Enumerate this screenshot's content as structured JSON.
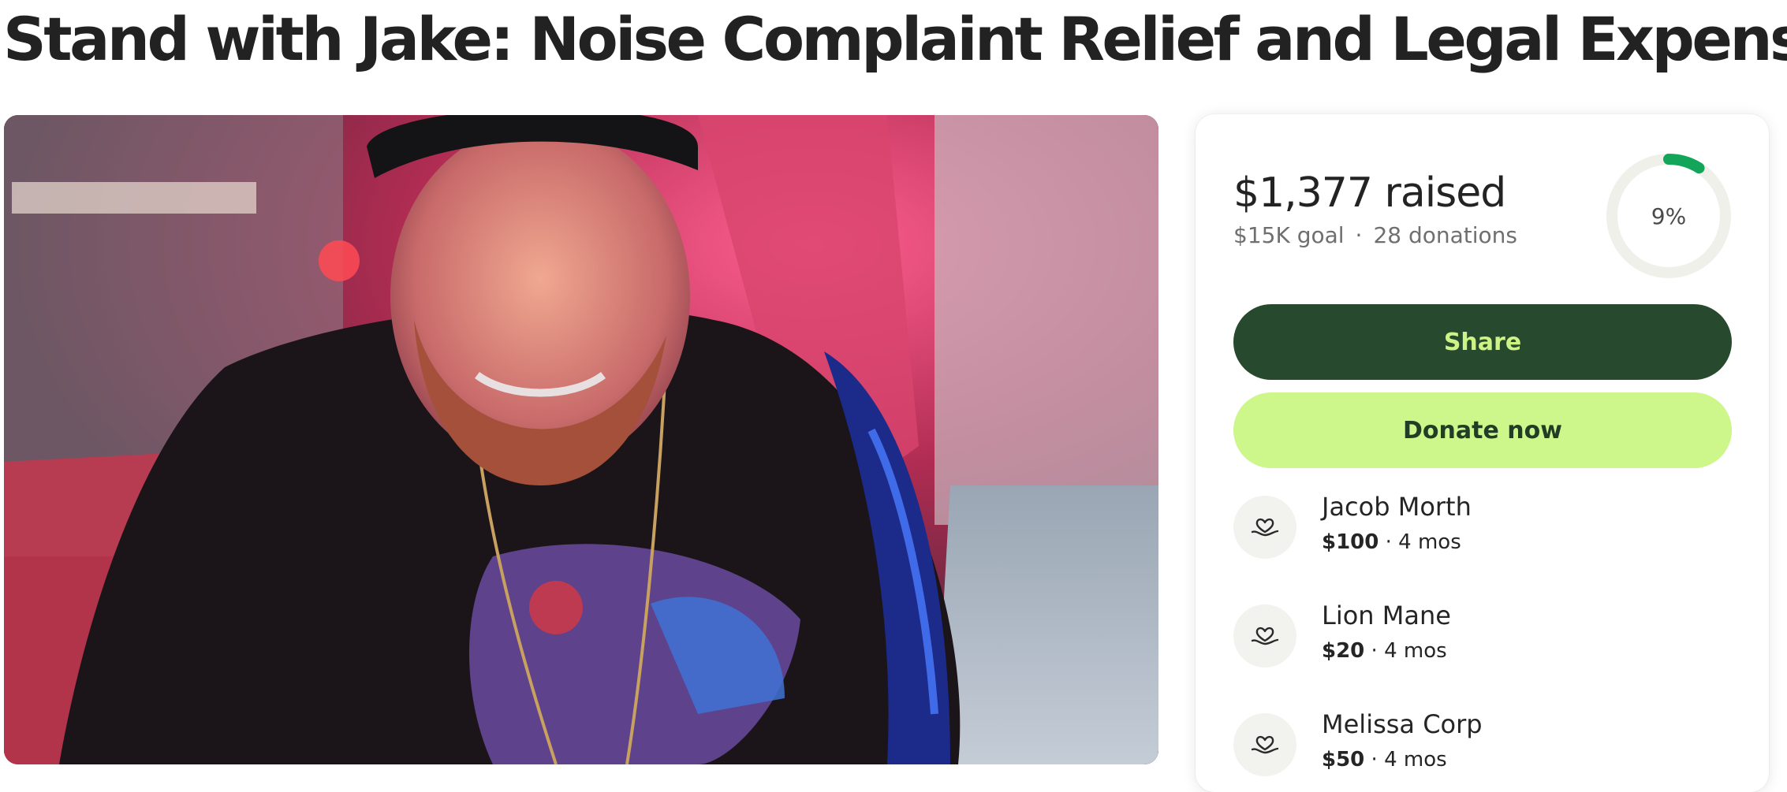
{
  "page": {
    "title": "Stand with Jake: Noise Complaint Relief and Legal Expenses"
  },
  "campaign": {
    "raised_label": "$1,377 raised",
    "goal_label": "$15K goal",
    "separator": "·",
    "donations_label": "28 donations",
    "progress_label": "9%",
    "progress_fraction": 0.09,
    "share_label": "Share",
    "donate_label": "Donate now"
  },
  "donations": [
    {
      "name": "Jacob Morth",
      "amount": "$100",
      "time": "· 4 mos"
    },
    {
      "name": "Lion Mane",
      "amount": "$20",
      "time": "· 4 mos"
    },
    {
      "name": "Melissa Corp",
      "amount": "$50",
      "time": "· 4 mos"
    }
  ],
  "colors": {
    "share_bg": "#274a2e",
    "share_text": "#cdf386",
    "donate_bg": "#cdf68b",
    "donate_text": "#213d26",
    "progress_accent": "#13a65a",
    "progress_track": "#f0f0ea"
  },
  "icons": {
    "donor_avatar": "heart-in-hand-icon"
  }
}
